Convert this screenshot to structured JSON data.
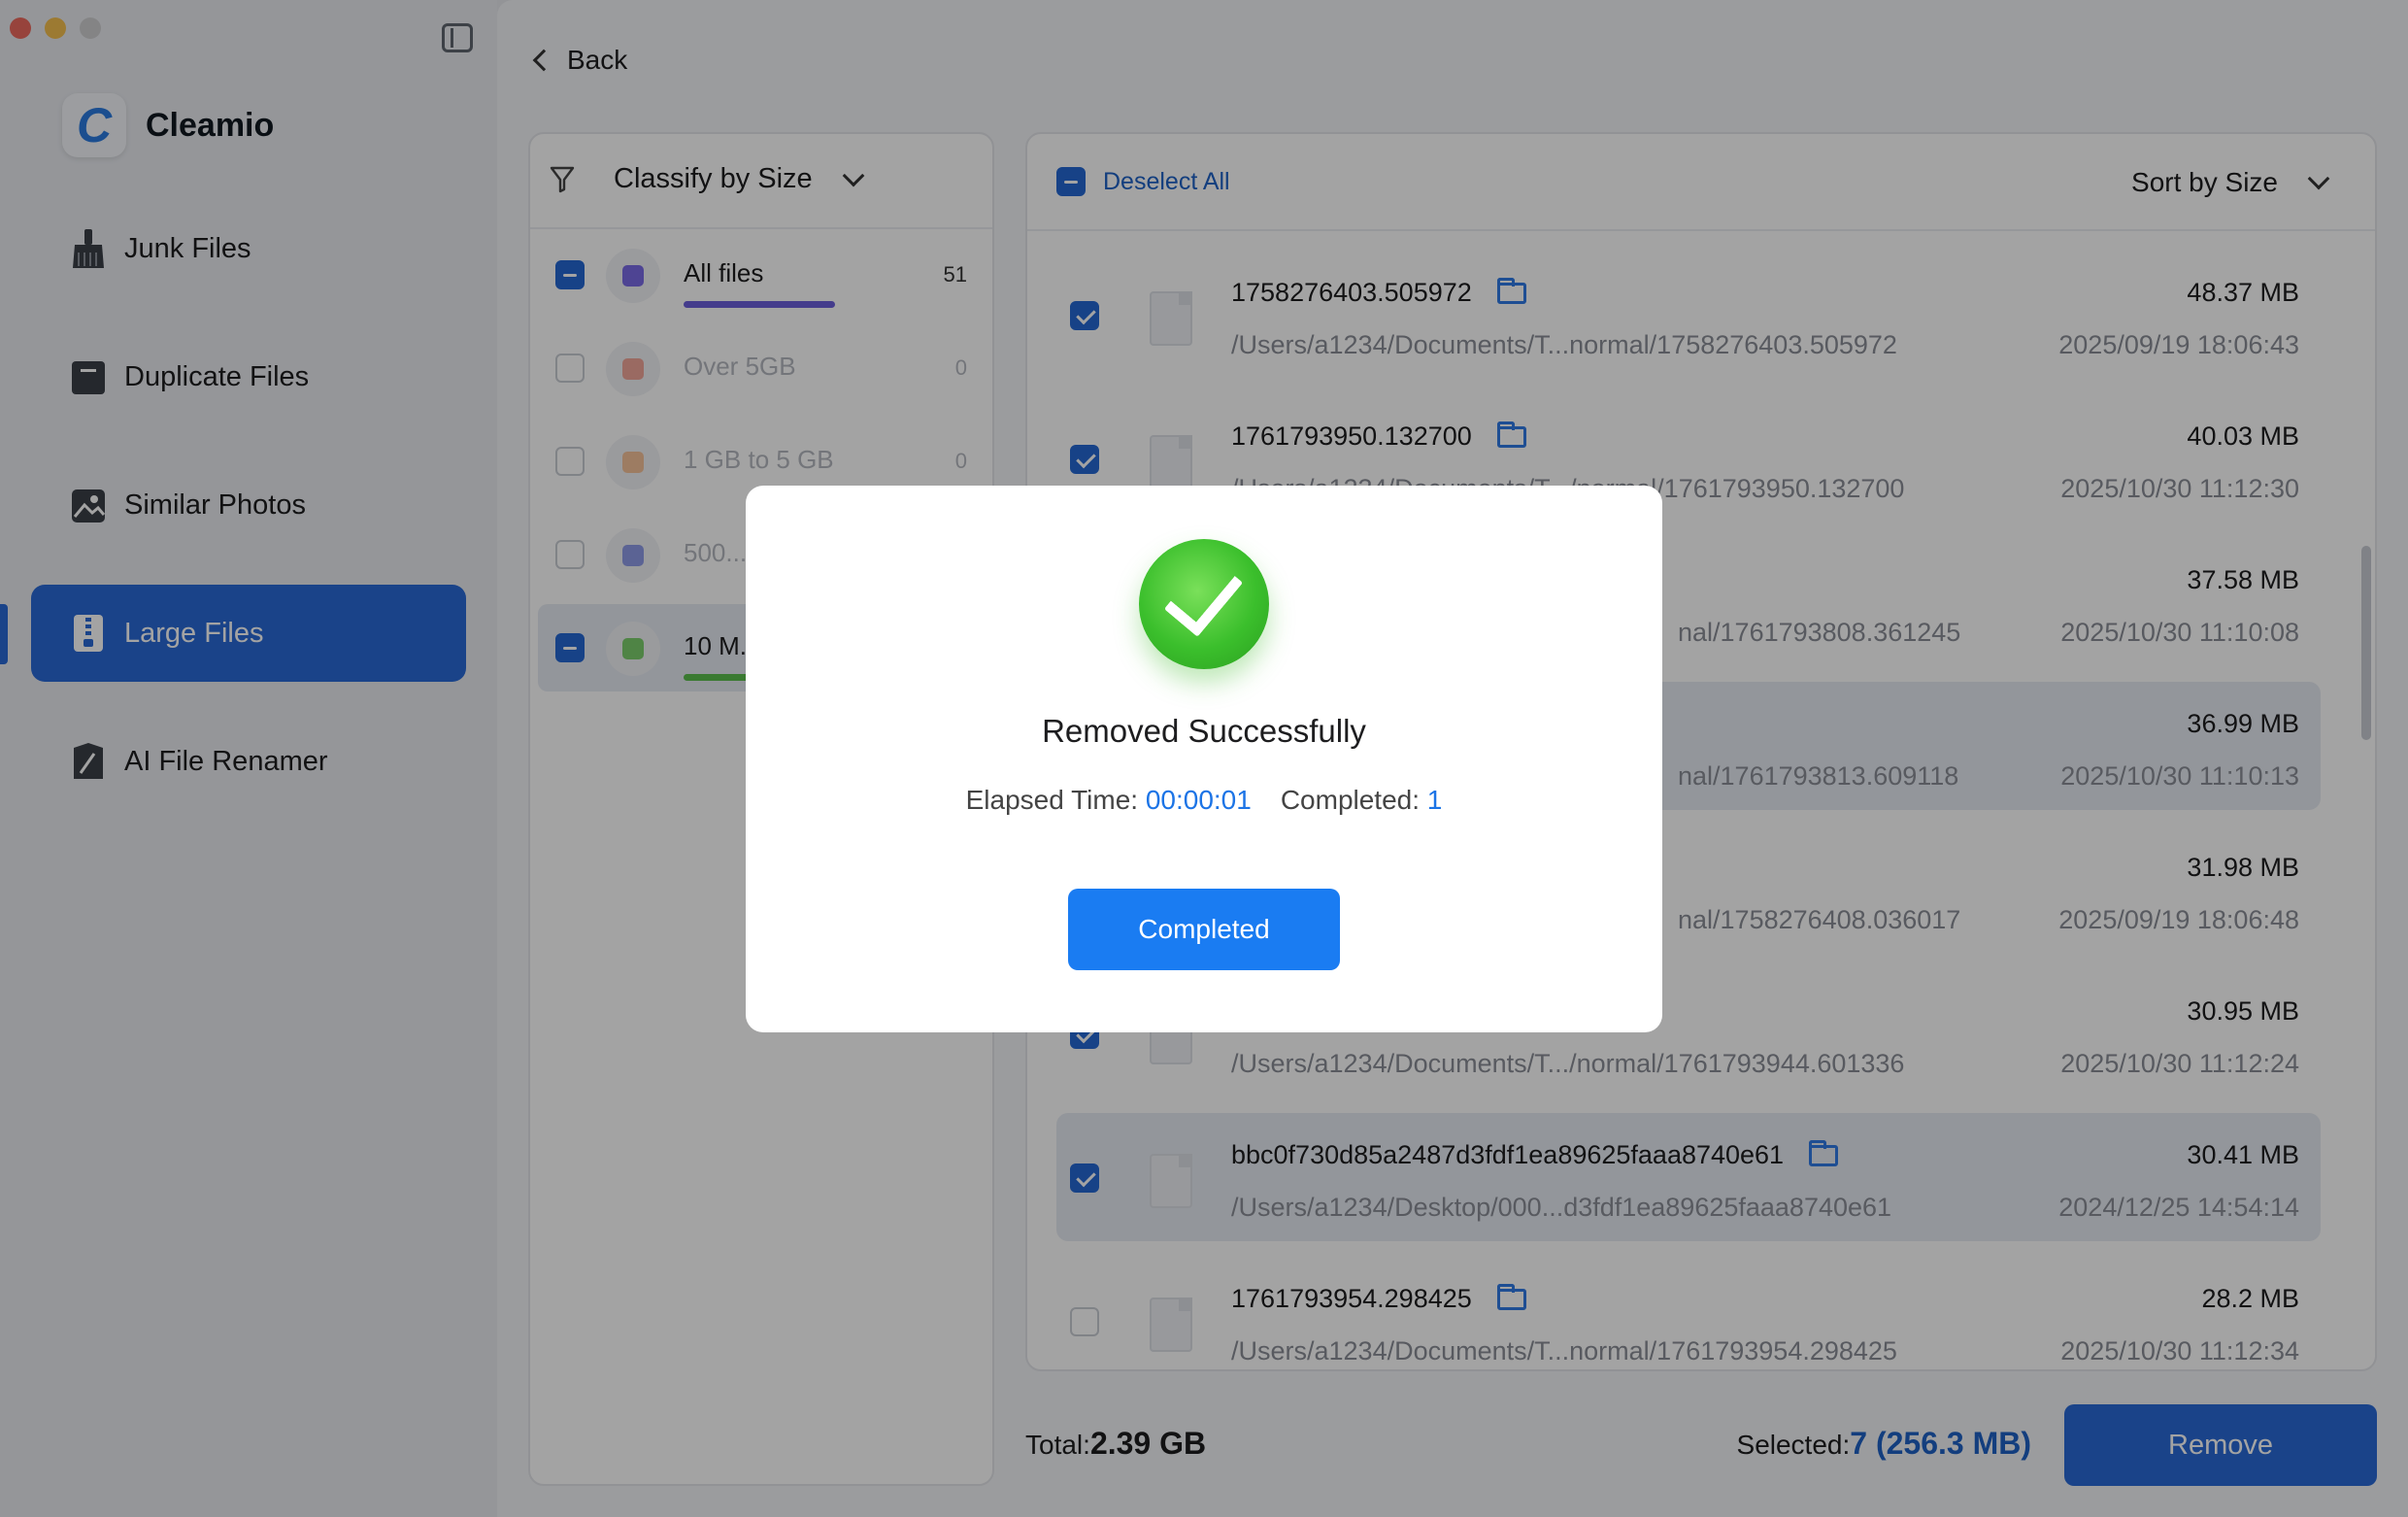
{
  "app": {
    "name": "Cleamio"
  },
  "sidebar": {
    "items": [
      {
        "label": "Junk Files"
      },
      {
        "label": "Duplicate Files"
      },
      {
        "label": "Similar Photos"
      },
      {
        "label": "Large Files"
      },
      {
        "label": "AI File Renamer"
      }
    ],
    "active_index": 3
  },
  "header": {
    "back_label": "Back"
  },
  "categories": {
    "classify_label": "Classify by Size",
    "items": [
      {
        "label": "All files",
        "count": "51",
        "color": "#7a6be6"
      },
      {
        "label": "Over 5GB",
        "count": "0",
        "color": "#f1a79a"
      },
      {
        "label": "1 GB to 5 GB",
        "count": "0",
        "color": "#f6c39a"
      },
      {
        "label": "500...",
        "count": "",
        "color": "#8f9be8"
      },
      {
        "label": "10 M...",
        "count": "",
        "color": "#7ccf6d"
      }
    ]
  },
  "files": {
    "deselect_label": "Deselect All",
    "sort_label": "Sort by Size",
    "rows": [
      {
        "name": "1758276403.505972",
        "path": "/Users/a1234/Documents/T...normal/1758276403.505972",
        "size": "48.37  MB",
        "date": "2025/09/19 18:06:43",
        "checked": true
      },
      {
        "name": "1761793950.132700",
        "path": "/Users/a1234/Documents/T.../normal/1761793950.132700",
        "size": "40.03  MB",
        "date": "2025/10/30 11:12:30",
        "checked": true
      },
      {
        "name": "",
        "path": "nal/1761793808.361245",
        "size": "37.58  MB",
        "date": "2025/10/30 11:10:08",
        "checked": true
      },
      {
        "name": "",
        "path": "nal/1761793813.609118",
        "size": "36.99  MB",
        "date": "2025/10/30 11:10:13",
        "checked": true
      },
      {
        "name": "",
        "path": "nal/1758276408.036017",
        "size": "31.98  MB",
        "date": "2025/09/19 18:06:48",
        "checked": true
      },
      {
        "name": "",
        "path": "/Users/a1234/Documents/T.../normal/1761793944.601336",
        "size": "30.95  MB",
        "date": "2025/10/30 11:12:24",
        "checked": true
      },
      {
        "name": "bbc0f730d85a2487d3fdf1ea89625faaa8740e61",
        "path": "/Users/a1234/Desktop/000...d3fdf1ea89625faaa8740e61",
        "size": "30.41  MB",
        "date": "2024/12/25 14:54:14",
        "checked": true
      },
      {
        "name": "1761793954.298425",
        "path": "/Users/a1234/Documents/T...normal/1761793954.298425",
        "size": "28.2  MB",
        "date": "2025/10/30 11:12:34",
        "checked": false
      }
    ]
  },
  "footer": {
    "total_label": "Total:",
    "total_value": "2.39 GB",
    "selected_label": "Selected:",
    "selected_value": "7 (256.3  MB)",
    "remove_label": "Remove"
  },
  "modal": {
    "title": "Removed Successfully",
    "elapsed_label": "Elapsed Time: ",
    "elapsed_value": "00:00:01",
    "completed_label": "Completed: ",
    "completed_value": "1",
    "button_label": "Completed"
  },
  "colors": {
    "accent": "#2a6ad6",
    "button": "#1a7cf2",
    "success": "#3bbf2c"
  }
}
